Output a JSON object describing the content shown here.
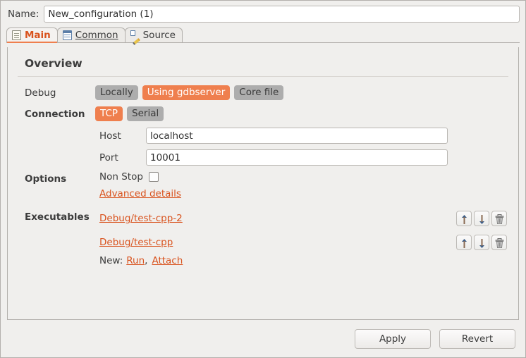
{
  "name_field": {
    "label": "Name:",
    "value": "New_configuration (1)"
  },
  "tabs": [
    {
      "label": "Main",
      "icon": "document-icon",
      "active": true
    },
    {
      "label": "Common",
      "icon": "table-icon",
      "active": false
    },
    {
      "label": "Source",
      "icon": "pencil-icon",
      "active": false
    }
  ],
  "panel": {
    "title": "Overview",
    "debug": {
      "label": "Debug",
      "options": [
        {
          "label": "Locally",
          "selected": false
        },
        {
          "label": "Using gdbserver",
          "selected": true
        },
        {
          "label": "Core file",
          "selected": false
        }
      ]
    },
    "connection": {
      "label": "Connection",
      "options": [
        {
          "label": "TCP",
          "selected": true
        },
        {
          "label": "Serial",
          "selected": false
        }
      ],
      "host": {
        "label": "Host",
        "value": "localhost"
      },
      "port": {
        "label": "Port",
        "value": "10001"
      }
    },
    "options": {
      "label": "Options",
      "non_stop": {
        "label": "Non Stop",
        "checked": false
      },
      "advanced_details": "Advanced details"
    },
    "executables": {
      "label": "Executables",
      "items": [
        {
          "name": "Debug/test-cpp-2"
        },
        {
          "name": "Debug/test-cpp"
        }
      ],
      "row_buttons": [
        {
          "icon": "arrow-up-icon",
          "title": "Move up"
        },
        {
          "icon": "arrow-down-icon",
          "title": "Move down"
        },
        {
          "icon": "trash-icon",
          "title": "Delete"
        }
      ],
      "new_label": "New:",
      "new_run": "Run",
      "new_separator": ",",
      "new_attach": "Attach"
    }
  },
  "footer": {
    "apply": "Apply",
    "revert": "Revert"
  },
  "colors": {
    "accent_orange": "#ef7f4e",
    "link_orange": "#d9531e",
    "pill_gray": "#adadad",
    "window_bg": "#f0efed"
  }
}
